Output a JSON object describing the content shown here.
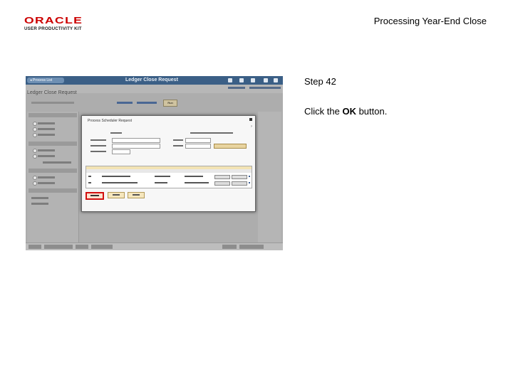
{
  "logo": {
    "brand": "ORACLE",
    "product": "USER PRODUCTIVITY KIT"
  },
  "document": {
    "title": "Processing Year-End Close"
  },
  "step": {
    "label": "Step 42"
  },
  "instruction": {
    "prefix": "Click the ",
    "target": "OK",
    "suffix": " button."
  },
  "screenshot": {
    "app_header_title": "Ledger Close Request",
    "process_list_label": "Process List",
    "page_title": "Ledger Close Request",
    "run_button": "Run",
    "dialog": {
      "title": "Process Scheduler Request",
      "ok_button": "OK",
      "cancel_button": "Cancel",
      "refresh_button": "Refresh"
    }
  },
  "colors": {
    "header": "#3b5f86",
    "ok_highlight": "#d21010",
    "doc_text": "#000000"
  }
}
